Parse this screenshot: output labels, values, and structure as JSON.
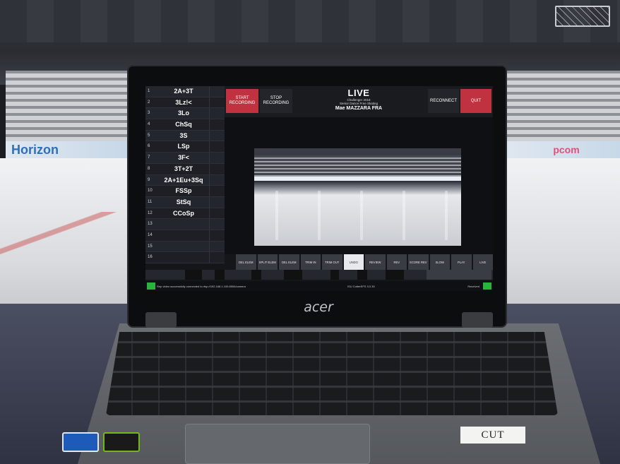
{
  "scene": {
    "banner_left": "Horizon",
    "banner_right": "pcom",
    "laptop_brand": "acer",
    "card_label": "CUT"
  },
  "app": {
    "start_recording": "START RECORDING",
    "stop_recording": "STOP RECORDING",
    "live": "LIVE",
    "event": "Challenger 2018",
    "segment": "Senior Dance Free Skating",
    "skater": "Mae MAZZARA FRA",
    "reconnect": "RECONNECT",
    "quit": "QUIT",
    "elements": [
      {
        "num": "1",
        "code": "2A+3T"
      },
      {
        "num": "2",
        "code": "3Lz!<"
      },
      {
        "num": "3",
        "code": "3Lo"
      },
      {
        "num": "4",
        "code": "ChSq"
      },
      {
        "num": "5",
        "code": "3S"
      },
      {
        "num": "6",
        "code": "LSp"
      },
      {
        "num": "7",
        "code": "3F<"
      },
      {
        "num": "8",
        "code": "3T+2T"
      },
      {
        "num": "9",
        "code": "2A+1Eu+3Sq"
      },
      {
        "num": "10",
        "code": "FSSp"
      },
      {
        "num": "11",
        "code": "StSq"
      },
      {
        "num": "12",
        "code": "CCoSp"
      },
      {
        "num": "13",
        "code": ""
      },
      {
        "num": "14",
        "code": ""
      },
      {
        "num": "15",
        "code": ""
      },
      {
        "num": "16",
        "code": ""
      }
    ],
    "controls": [
      "DEL ELEM",
      "SPLIT ELEM",
      "DEL ELEM",
      "TRIM IN",
      "TRIM OUT",
      "UNDO",
      "REVIEW",
      "REV",
      "SCORE REV",
      "SLOW",
      "PLAY",
      "LIVE"
    ],
    "status": "Rep video successfully connected to rtsp://192.168.1.100:8554/camera",
    "version": "ISU CutterEFS 3.0.30",
    "received": "Received"
  },
  "colors": {
    "record_red": "#c0323f",
    "status_green": "#29b43d",
    "panel_dark": "#1a1b1f"
  }
}
